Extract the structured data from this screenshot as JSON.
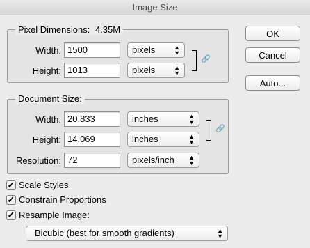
{
  "window": {
    "title": "Image Size"
  },
  "pixel_dimensions": {
    "legend": "Pixel Dimensions:",
    "size": "4.35M",
    "width_label": "Width:",
    "width_value": "1500",
    "width_unit": "pixels",
    "height_label": "Height:",
    "height_value": "1013",
    "height_unit": "pixels"
  },
  "document_size": {
    "legend": "Document Size:",
    "width_label": "Width:",
    "width_value": "20.833",
    "width_unit": "inches",
    "height_label": "Height:",
    "height_value": "14.069",
    "height_unit": "inches",
    "resolution_label": "Resolution:",
    "resolution_value": "72",
    "resolution_unit": "pixels/inch"
  },
  "options": {
    "scale_styles": "Scale Styles",
    "constrain_proportions": "Constrain Proportions",
    "resample_image": "Resample Image:",
    "resample_method": "Bicubic (best for smooth gradients)"
  },
  "buttons": {
    "ok": "OK",
    "cancel": "Cancel",
    "auto": "Auto..."
  }
}
